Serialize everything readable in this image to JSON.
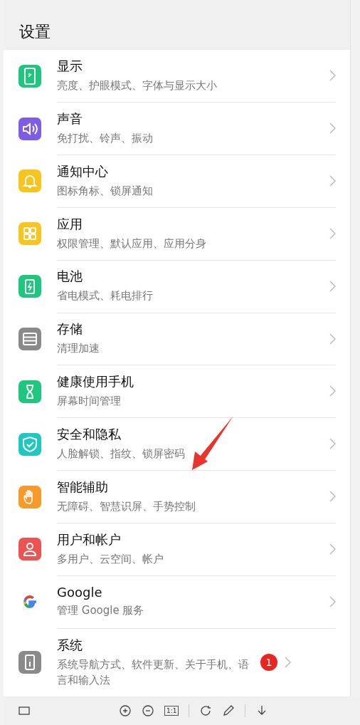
{
  "header": {
    "title": "设置"
  },
  "items": [
    {
      "kind": "display",
      "color": "#1fc77e",
      "title": "显示",
      "subtitle": "亮度、护眼模式、字体与显示大小"
    },
    {
      "kind": "sound",
      "color": "#7d5ce6",
      "title": "声音",
      "subtitle": "免打扰、铃声、振动"
    },
    {
      "kind": "bell",
      "color": "#f7c51e",
      "title": "通知中心",
      "subtitle": "图标角标、锁屏通知"
    },
    {
      "kind": "apps",
      "color": "#f7c51e",
      "title": "应用",
      "subtitle": "权限管理、默认应用、应用分身"
    },
    {
      "kind": "battery",
      "color": "#1fc77e",
      "title": "电池",
      "subtitle": "省电模式、耗电排行"
    },
    {
      "kind": "storage",
      "color": "#8a8a8a",
      "title": "存储",
      "subtitle": "清理加速"
    },
    {
      "kind": "hourglass",
      "color": "#1fc77e",
      "title": "健康使用手机",
      "subtitle": "屏幕时间管理"
    },
    {
      "kind": "shield",
      "color": "#1ec8c0",
      "title": "安全和隐私",
      "subtitle": "人脸解锁、指纹、锁屏密码"
    },
    {
      "kind": "hand",
      "color": "#f79a2a",
      "title": "智能辅助",
      "subtitle": "无障碍、智慧识屏、手势控制"
    },
    {
      "kind": "user",
      "color": "#ec5454",
      "title": "用户和帐户",
      "subtitle": "多用户、云空间、帐户"
    },
    {
      "kind": "google",
      "color": "#ffffff",
      "title": "Google",
      "subtitle": "管理 Google 服务"
    },
    {
      "kind": "info",
      "color": "#8a8a8a",
      "title": "系统",
      "subtitle": "系统导航方式、软件更新、关于手机、语言和输入法",
      "badge": "1"
    }
  ],
  "toolbar": {
    "items": [
      {
        "kind": "square"
      },
      {
        "kind": "zoom-in"
      },
      {
        "kind": "zoom-out"
      },
      {
        "kind": "actual",
        "label": "1:1"
      },
      {
        "kind": "rotate"
      },
      {
        "kind": "pencil"
      },
      {
        "kind": "download"
      }
    ]
  }
}
